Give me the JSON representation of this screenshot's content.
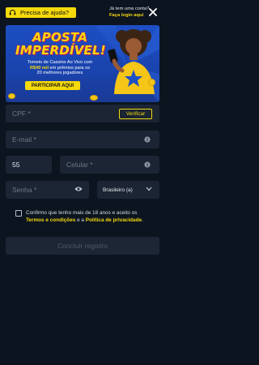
{
  "header": {
    "help_label": "Precisa de ajuda?",
    "account_question": "Já tem uma conta?",
    "login_link": "Faça login aqui",
    "accent_color": "#f5d90a"
  },
  "banner": {
    "title_line1": "APOSTA",
    "title_line2": "IMPERDÍVEL!",
    "desc_line1": "Torneio de Cassino Ao Vivo com",
    "desc_amount": "R$40 mil",
    "desc_line2_rest": " em prêmios para os",
    "desc_line3": "20 melhores jogadores",
    "cta_label": "PARTICIPAR AQUI"
  },
  "form": {
    "cpf_placeholder": "CPF *",
    "verify_label": "Verificar",
    "email_placeholder": "E-mail *",
    "country_code": "55",
    "phone_placeholder": "Celular *",
    "password_placeholder": "Senha *",
    "nationality_value": "Brasileiro (a)",
    "consent_prefix": "Confirmo que tenho mais de 18 anos e aceito os",
    "terms_link": "Termos e condições",
    "consent_mid": " e a ",
    "privacy_link": "Política de privacidade",
    "consent_end": ".",
    "submit_label": "Concluir registro"
  },
  "icons": {
    "help": "headset-icon",
    "close": "close-icon",
    "info": "info-icon",
    "eye": "eye-icon",
    "chevron": "chevron-down-icon"
  }
}
